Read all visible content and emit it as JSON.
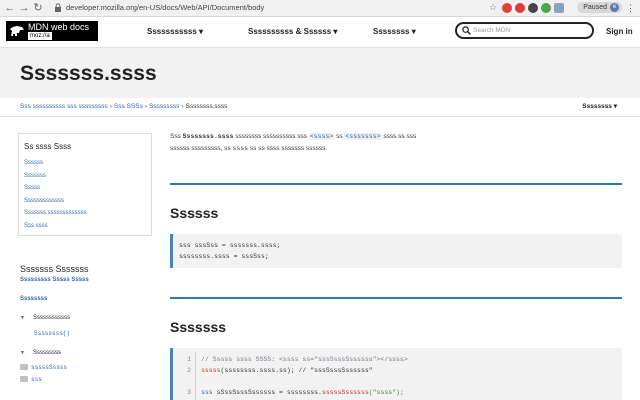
{
  "browser": {
    "url": "developer.mozilla.org/en-US/docs/Web/API/Document/body",
    "paused_label": "Paused",
    "avatar_letter": "e"
  },
  "header": {
    "logo_line1": "MDN web docs",
    "logo_line2": "moz://a",
    "menu": [
      "Sssssssssss ▾",
      "Ssssssssss & Ssssss ▾",
      "Ssssssss ▾"
    ],
    "search_placeholder": "Search MDN",
    "signin": "Sign in"
  },
  "page": {
    "title": "Sssssss.ssss",
    "breadcrumbs": [
      "Sss ssssssssss sss sssssssss",
      "Sss SSSs",
      "Sssssssss",
      "Ssssssss.ssss"
    ],
    "language": "Ssssssss ▾"
  },
  "toc": {
    "heading": "Ss ssss Ssss",
    "items": [
      "Ssssss",
      "Sssssss",
      "Sssss",
      "Sssssssssssss",
      "Sssssss sssssssssssss",
      "Sss ssss"
    ]
  },
  "related": {
    "heading": "Sssssss Sssssss",
    "subheading": "Sssssssss Sssss Sssss",
    "item": "Ssssssss",
    "group1": "Ssssssssssss",
    "group1_child": "Ssssssss()",
    "group2": "Sssssssss",
    "child_a": "sssssSssss",
    "child_b": "sss"
  },
  "content": {
    "intro_a": "Sss",
    "intro_strong": "Ssssssss.ssss",
    "intro_b": "ssssssss ssssssssss sss",
    "intro_code1": "<ssss>",
    "intro_c": "ss",
    "intro_code2": "<sssssss>",
    "intro_d": "ssss ss sss",
    "intro_line2a": "ssssss sssssssss, ss",
    "intro_code3": "ssss",
    "intro_line2b": "ss ss ssss sssssss ssssss.",
    "syntax_heading": "Ssssss",
    "syntax_line1": "sss sssSss = sssssss.ssss;",
    "syntax_line2": "ssssssss.ssss = sssSss;",
    "example_heading": "Sssssss",
    "code": {
      "line1": "// Sssss ssss SSSS: <ssss ss=\"sssSsssSssssss\"></ssss>",
      "line2_fn": "sssss",
      "line2_rest": "(ssssssss.ssss.ss); // \"sssSsssSssssss\"",
      "line3_kw": "sss",
      "line3_rest": "sSssSsssSssssss = ssssssss.",
      "line3_fn": "sssssSssssss",
      "line3_str": "(\"ssss\");"
    },
    "line_numbers": [
      "1",
      "2",
      "3"
    ]
  },
  "colors": {
    "accent": "#2b7bb0",
    "link": "#3366aa"
  }
}
